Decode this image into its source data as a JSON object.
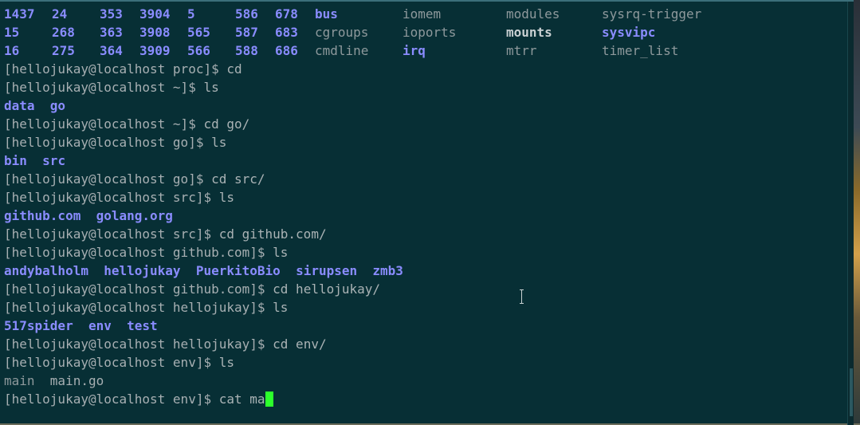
{
  "proc_listing": [
    [
      "1437",
      "24",
      "353",
      "3904",
      "5",
      "586",
      "678",
      "bus",
      "iomem",
      "modules",
      "sysrq-trigger"
    ],
    [
      "15",
      "268",
      "363",
      "3908",
      "565",
      "587",
      "683",
      "cgroups",
      "ioports",
      "mounts",
      "sysvipc"
    ],
    [
      "16",
      "275",
      "364",
      "3909",
      "566",
      "588",
      "686",
      "cmdline",
      "irq",
      "mtrr",
      "timer_list"
    ]
  ],
  "lines": [
    {
      "prompt": "[hellojukay@localhost proc]$ ",
      "cmd": "cd"
    },
    {
      "prompt": "[hellojukay@localhost ~]$ ",
      "cmd": "ls"
    },
    {
      "out_dirs": [
        "data",
        "go"
      ]
    },
    {
      "prompt": "[hellojukay@localhost ~]$ ",
      "cmd": "cd go/"
    },
    {
      "prompt": "[hellojukay@localhost go]$ ",
      "cmd": "ls"
    },
    {
      "out_dirs": [
        "bin",
        "src"
      ]
    },
    {
      "prompt": "[hellojukay@localhost go]$ ",
      "cmd": "cd src/"
    },
    {
      "prompt": "[hellojukay@localhost src]$ ",
      "cmd": "ls"
    },
    {
      "out_dirs": [
        "github.com",
        "golang.org"
      ]
    },
    {
      "prompt": "[hellojukay@localhost src]$ ",
      "cmd": "cd github.com/"
    },
    {
      "prompt": "[hellojukay@localhost github.com]$ ",
      "cmd": "ls"
    },
    {
      "out_dirs": [
        "andybalholm",
        "hellojukay",
        "PuerkitoBio",
        "sirupsen",
        "zmb3"
      ]
    },
    {
      "prompt": "[hellojukay@localhost github.com]$ ",
      "cmd": "cd hellojukay/"
    },
    {
      "prompt": "[hellojukay@localhost hellojukay]$ ",
      "cmd": "ls"
    },
    {
      "out_dirs": [
        "517spider",
        "env",
        "test"
      ]
    },
    {
      "prompt": "[hellojukay@localhost hellojukay]$ ",
      "cmd": "cd env/"
    },
    {
      "prompt": "[hellojukay@localhost env]$ ",
      "cmd": "ls"
    },
    {
      "out_files": [
        "main",
        "main.go"
      ]
    },
    {
      "prompt": "[hellojukay@localhost env]$ ",
      "cmd": "cat ma",
      "cursor": true
    }
  ],
  "colors": {
    "background": "#072f35",
    "directory": "#8a8cff",
    "cursor": "#2cff2c",
    "text": "#a7afb2"
  }
}
